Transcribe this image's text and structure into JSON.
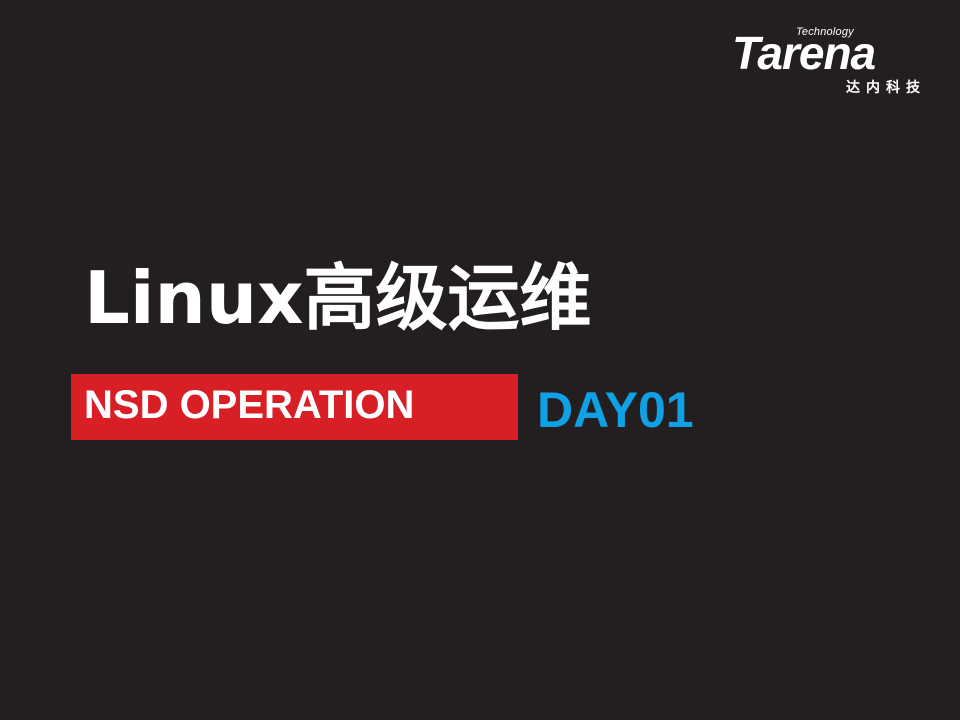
{
  "logo": {
    "tagline": "Technology",
    "wordmark": "Tarena",
    "chinese_name": "达内科技"
  },
  "title": "Linux高级运维",
  "course_banner": {
    "label": "NSD OPERATION",
    "color": "#d91f26"
  },
  "day": {
    "label": "DAY01",
    "color": "#0fa0e6"
  },
  "background_color": "#231f20"
}
